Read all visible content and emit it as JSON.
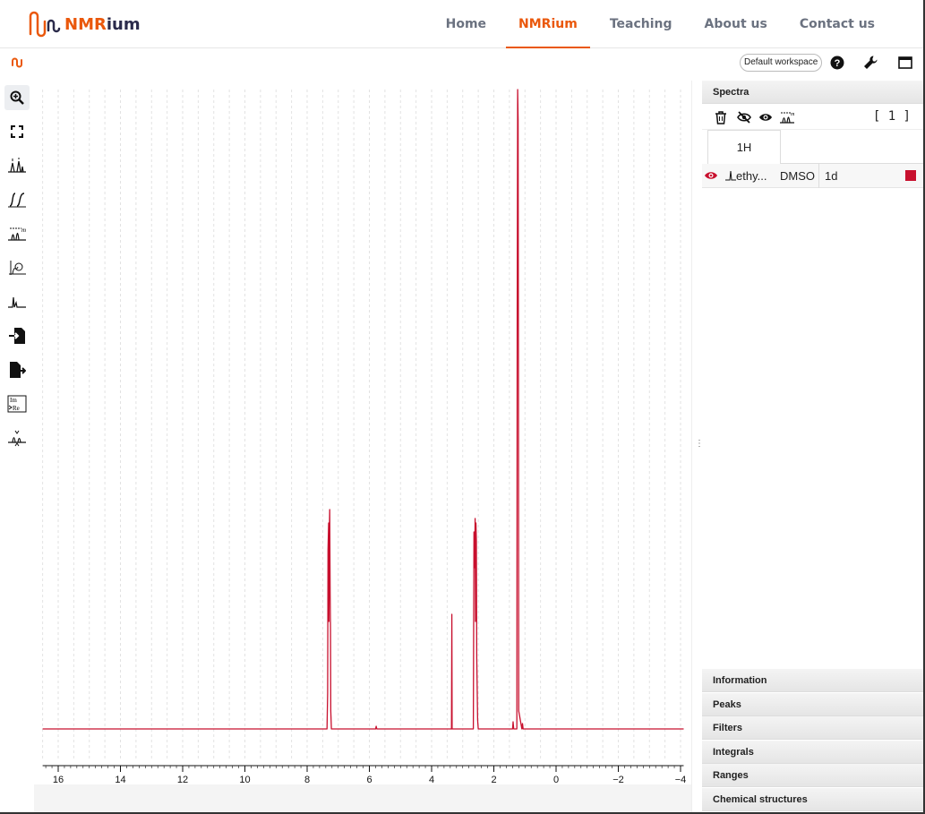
{
  "brand": {
    "nm": "NMR",
    "rium": "ium",
    "color": "#ea580c"
  },
  "nav": [
    {
      "label": "Home",
      "active": false
    },
    {
      "label": "NMRium",
      "active": true
    },
    {
      "label": "Teaching",
      "active": false
    },
    {
      "label": "About us",
      "active": false
    },
    {
      "label": "Contact us",
      "active": false
    }
  ],
  "toolbar": {
    "workspace_label": "Default workspace",
    "icons": [
      "help-icon",
      "wrench-icon",
      "window-icon"
    ]
  },
  "left_tools": [
    "zoom-icon",
    "full-screen-icon",
    "peak-picking-icon",
    "integral-icon",
    "multiplet-icon",
    "phase-correction-icon",
    "baseline-icon",
    "import-icon",
    "export-icon",
    "exclusion-zones-icon",
    "alignment-icon"
  ],
  "spectrum": {
    "color": "#c8102e",
    "axis_ticks": [
      "16",
      "14",
      "12",
      "10",
      "8",
      "6",
      "4",
      "2",
      "0",
      "−2",
      "−4"
    ]
  },
  "right_panel": {
    "spectra_title": "Spectra",
    "count": "[ 1 ]",
    "tab": "1H",
    "spectrum_row": {
      "name": "ethy...",
      "solvent": "DMSO",
      "dimension": "1d",
      "color": "#c8102e"
    },
    "accordions": [
      "Information",
      "Peaks",
      "Filters",
      "Integrals",
      "Ranges",
      "Chemical structures"
    ]
  }
}
